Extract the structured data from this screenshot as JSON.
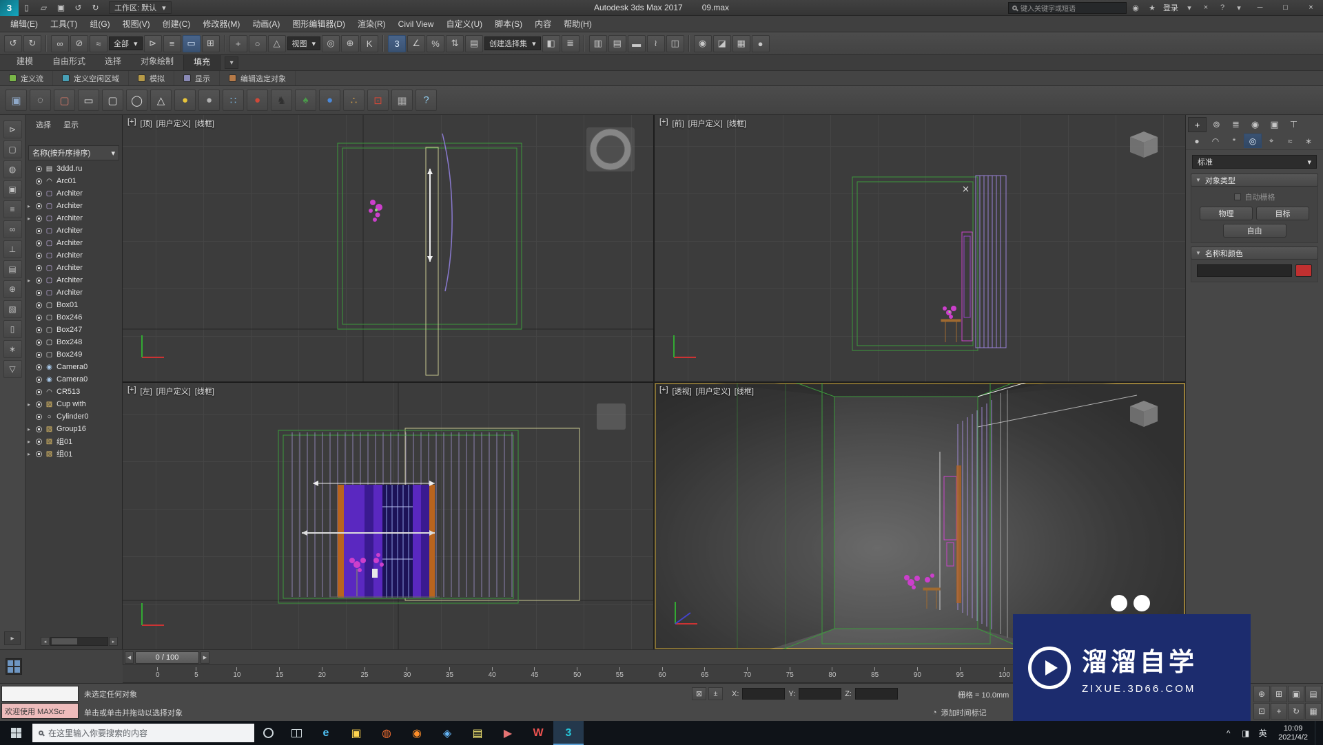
{
  "ui": {
    "caret_down": "▾",
    "arrow_left": "◀",
    "arrow_right": "▶",
    "arrow_small_left": "◂",
    "arrow_small_right": "▸",
    "roll_open": "▼"
  },
  "window": {
    "minimize": "─",
    "maximize": "□",
    "close": "×"
  },
  "titlebar": {
    "logo_glyph": "3",
    "workspace": "工作区: 默认",
    "app_title": "Autodesk 3ds Max 2017",
    "file_title": "09.max",
    "search_placeholder": "键入关键字或短语",
    "signin": "登录",
    "quick_icons": [
      {
        "name": "new-scene-icon",
        "glyph": "▯"
      },
      {
        "name": "open-file-icon",
        "glyph": "▱"
      },
      {
        "name": "save-file-icon",
        "glyph": "▣"
      },
      {
        "name": "undo-icon",
        "glyph": "↺"
      },
      {
        "name": "redo-icon",
        "glyph": "↻"
      }
    ],
    "right_icons_a": [
      {
        "name": "communication-center-icon",
        "glyph": "◉"
      },
      {
        "name": "favorites-icon",
        "glyph": "★"
      }
    ],
    "right_icons_b": [
      {
        "name": "autodesk-exchange-icon",
        "glyph": "×"
      },
      {
        "name": "infocenter-help-icon",
        "glyph": "?"
      }
    ]
  },
  "menus": [
    {
      "label": "编辑(E)",
      "name": "menu-edit"
    },
    {
      "label": "工具(T)",
      "name": "menu-tools"
    },
    {
      "label": "组(G)",
      "name": "menu-group"
    },
    {
      "label": "视图(V)",
      "name": "menu-views"
    },
    {
      "label": "创建(C)",
      "name": "menu-create"
    },
    {
      "label": "修改器(M)",
      "name": "menu-modifiers"
    },
    {
      "label": "动画(A)",
      "name": "menu-animation"
    },
    {
      "label": "图形编辑器(D)",
      "name": "menu-graph-editors"
    },
    {
      "label": "渲染(R)",
      "name": "menu-rendering"
    },
    {
      "label": "Civil View",
      "name": "menu-civil-view"
    },
    {
      "label": "自定义(U)",
      "name": "menu-customize"
    },
    {
      "label": "脚本(S)",
      "name": "menu-scripting"
    },
    {
      "label": "内容",
      "name": "menu-content"
    },
    {
      "label": "帮助(H)",
      "name": "menu-help"
    }
  ],
  "main_toolbar": {
    "filter_dropdown": "全部",
    "coord_dropdown": "视图",
    "sets_dropdown": "创建选择集",
    "group1": [
      {
        "name": "undo-icon",
        "glyph": "↺"
      },
      {
        "name": "redo-icon",
        "glyph": "↻"
      }
    ],
    "group2": [
      {
        "name": "select-and-link-icon",
        "glyph": "∞"
      },
      {
        "name": "unlink-selection-icon",
        "glyph": "⊘"
      },
      {
        "name": "bind-to-space-warp-icon",
        "glyph": "≈"
      }
    ],
    "group3": [
      {
        "name": "select-object-icon",
        "glyph": "⊳"
      },
      {
        "name": "select-by-name-icon",
        "glyph": "≡"
      },
      {
        "name": "rectangular-selection-region-icon",
        "glyph": "▭",
        "cls": "hl"
      },
      {
        "name": "window-crossing-toggle-icon",
        "glyph": "⊞"
      }
    ],
    "group4": [
      {
        "name": "select-and-move-icon",
        "glyph": "+"
      },
      {
        "name": "select-and-rotate-icon",
        "glyph": "○"
      },
      {
        "name": "select-and-scale-icon",
        "glyph": "△"
      }
    ],
    "group5": [
      {
        "name": "use-pivot-center-icon",
        "glyph": "◎"
      },
      {
        "name": "select-and-manipulate-icon",
        "glyph": "⊕"
      },
      {
        "name": "keyboard-override-icon",
        "glyph": "K"
      }
    ],
    "group6": [
      {
        "name": "snaps-toggle-icon",
        "glyph": "3",
        "cls": "hl"
      },
      {
        "name": "angle-snap-icon",
        "glyph": "∠"
      },
      {
        "name": "percent-snap-icon",
        "glyph": "%"
      },
      {
        "name": "spinner-snap-icon",
        "glyph": "⇅"
      }
    ],
    "group7": [
      {
        "name": "edit-named-selection-sets-icon",
        "glyph": "▤"
      }
    ],
    "group8": [
      {
        "name": "mirror-icon",
        "glyph": "◧"
      },
      {
        "name": "align-icon",
        "glyph": "≣"
      }
    ],
    "group9": [
      {
        "name": "toggle-scene-explorer-icon",
        "glyph": "▥"
      },
      {
        "name": "toggle-layer-explorer-icon",
        "glyph": "▤"
      },
      {
        "name": "toggle-ribbon-icon",
        "glyph": "▬"
      }
    ],
    "group10": [
      {
        "name": "curve-editor-icon",
        "glyph": "≀"
      },
      {
        "name": "schematic-view-icon",
        "glyph": "◫"
      }
    ],
    "group11": [
      {
        "name": "material-editor-icon",
        "glyph": "◉"
      },
      {
        "name": "render-setup-icon",
        "glyph": "◪"
      },
      {
        "name": "rendered-frame-icon",
        "glyph": "▦"
      },
      {
        "name": "render-production-icon",
        "glyph": "●"
      }
    ]
  },
  "ribbon": {
    "tabs": [
      {
        "label": "建模",
        "name": "ribbon-tab-modeling"
      },
      {
        "label": "自由形式",
        "name": "ribbon-tab-freeform"
      },
      {
        "label": "选择",
        "name": "ribbon-tab-selection"
      },
      {
        "label": "对象绘制",
        "name": "ribbon-tab-object-paint"
      },
      {
        "label": "填充",
        "name": "ribbon-tab-populate"
      }
    ],
    "active_index": 4,
    "sub_buttons": [
      {
        "label": "定义流",
        "color": "#7ab648",
        "name": "populate-define-flow-button"
      },
      {
        "label": "定义空闲区域",
        "color": "#48a0b6",
        "name": "populate-define-idle-area-button"
      },
      {
        "label": "模拟",
        "color": "#b69a48",
        "name": "populate-simulate-button"
      },
      {
        "label": "显示",
        "color": "#8a8ab6",
        "name": "populate-display-button"
      },
      {
        "label": "编辑选定对象",
        "color": "#b67a48",
        "name": "populate-edit-selected-button"
      }
    ]
  },
  "secondary_toolbar": {
    "icons": [
      {
        "name": "viewport-tool-icon",
        "glyph": "▣",
        "color": "#8fa8c8"
      },
      {
        "name": "cloud-icon",
        "glyph": "◌",
        "color": "#d8d8d8"
      },
      {
        "name": "display-monitor-icon",
        "glyph": "▢",
        "color": "#d87a6a"
      },
      {
        "name": "rectangle-tool-icon",
        "glyph": "▭",
        "color": "#e0e0e0"
      },
      {
        "name": "rounded-rectangle-tool-icon",
        "glyph": "▢",
        "color": "#e0e0e0"
      },
      {
        "name": "ellipse-tool-icon",
        "glyph": "◯",
        "color": "#e0e0e0"
      },
      {
        "name": "cone-tool-icon",
        "glyph": "△",
        "color": "#e0e0e0"
      },
      {
        "name": "sun-light-icon",
        "glyph": "●",
        "color": "#e8c53a"
      },
      {
        "name": "sphere-tool-icon",
        "glyph": "●",
        "color": "#b0b0b0"
      },
      {
        "name": "scatter-grid-icon",
        "glyph": "∷",
        "color": "#7ab0d8"
      },
      {
        "name": "red-sphere-icon",
        "glyph": "●",
        "color": "#d04838"
      },
      {
        "name": "figure-icon",
        "glyph": "♞",
        "color": "#303030"
      },
      {
        "name": "foliage-icon",
        "glyph": "♠",
        "color": "#4a9a4a"
      },
      {
        "name": "blue-sphere-icon",
        "glyph": "●",
        "color": "#4a88d8"
      },
      {
        "name": "color-dots-icon",
        "glyph": "∴",
        "color": "#d8a04a"
      },
      {
        "name": "target-point-icon",
        "glyph": "⊡",
        "color": "#d04838"
      },
      {
        "name": "building-icon",
        "glyph": "▦",
        "color": "#a8a8a8"
      },
      {
        "name": "help-icon",
        "glyph": "?",
        "color": "#8fc8e8"
      }
    ]
  },
  "left_strip": {
    "icons": [
      {
        "name": "select-cursor-icon",
        "glyph": "⊳"
      },
      {
        "name": "selection-window-icon",
        "glyph": "▢"
      },
      {
        "name": "lamp-icon",
        "glyph": "◍"
      },
      {
        "name": "monitor-icon",
        "glyph": "▣"
      },
      {
        "name": "panel-list-icon",
        "glyph": "≡"
      },
      {
        "name": "link-chain-icon",
        "glyph": "∞"
      },
      {
        "name": "wrench-icon",
        "glyph": "⊥"
      },
      {
        "name": "palette-icon",
        "glyph": "▤"
      },
      {
        "name": "target-icon",
        "glyph": "⊕"
      },
      {
        "name": "cube-icon",
        "glyph": "▧"
      },
      {
        "name": "document-icon",
        "glyph": "▯"
      },
      {
        "name": "asterisk-icon",
        "glyph": "∗"
      },
      {
        "name": "filter-icon",
        "glyph": "▽"
      }
    ]
  },
  "scene_explorer": {
    "menu_select": "选择",
    "menu_display": "显示",
    "sort_header": "名称(按升序排序)",
    "items": [
      {
        "label": "3ddd.ru",
        "icon_name": "layer-icon",
        "glyph": "▤",
        "color": "#d8d8d8",
        "arrow": ""
      },
      {
        "label": "Arc01",
        "icon_name": "arc-shape-icon",
        "glyph": "◠",
        "color": "#d8d8d8",
        "arrow": ""
      },
      {
        "label": "Architer",
        "icon_name": "architecture-object-icon",
        "glyph": "▢",
        "color": "#c8b4e8",
        "arrow": ""
      },
      {
        "label": "Architer",
        "icon_name": "architecture-object-icon",
        "glyph": "▢",
        "color": "#c8b4e8",
        "arrow": "▸"
      },
      {
        "label": "Architer",
        "icon_name": "architecture-object-icon",
        "glyph": "▢",
        "color": "#c8b4e8",
        "arrow": "▸"
      },
      {
        "label": "Architer",
        "icon_name": "architecture-object-icon",
        "glyph": "▢",
        "color": "#c8b4e8",
        "arrow": ""
      },
      {
        "label": "Architer",
        "icon_name": "architecture-object-icon",
        "glyph": "▢",
        "color": "#c8b4e8",
        "arrow": ""
      },
      {
        "label": "Architer",
        "icon_name": "architecture-object-icon",
        "glyph": "▢",
        "color": "#c8b4e8",
        "arrow": ""
      },
      {
        "label": "Architer",
        "icon_name": "architecture-object-icon",
        "glyph": "▢",
        "color": "#c8b4e8",
        "arrow": ""
      },
      {
        "label": "Architer",
        "icon_name": "architecture-object-icon",
        "glyph": "▢",
        "color": "#c8b4e8",
        "arrow": "▸"
      },
      {
        "label": "Architer",
        "icon_name": "architecture-object-icon",
        "glyph": "▢",
        "color": "#c8b4e8",
        "arrow": ""
      },
      {
        "label": "Box01",
        "icon_name": "box-object-icon",
        "glyph": "▢",
        "color": "#d8d8d8",
        "arrow": ""
      },
      {
        "label": "Box246",
        "icon_name": "box-object-icon",
        "glyph": "▢",
        "color": "#d8d8d8",
        "arrow": ""
      },
      {
        "label": "Box247",
        "icon_name": "box-object-icon",
        "glyph": "▢",
        "color": "#d8d8d8",
        "arrow": ""
      },
      {
        "label": "Box248",
        "icon_name": "box-object-icon",
        "glyph": "▢",
        "color": "#d8d8d8",
        "arrow": ""
      },
      {
        "label": "Box249",
        "icon_name": "box-object-icon",
        "glyph": "▢",
        "color": "#d8d8d8",
        "arrow": ""
      },
      {
        "label": "Camera0",
        "icon_name": "camera-object-icon",
        "glyph": "◉",
        "color": "#a8c8e8",
        "arrow": ""
      },
      {
        "label": "Camera0",
        "icon_name": "camera-object-icon",
        "glyph": "◉",
        "color": "#a8c8e8",
        "arrow": ""
      },
      {
        "label": "CR513",
        "icon_name": "shape-object-icon",
        "glyph": "◠",
        "color": "#d8d8d8",
        "arrow": ""
      },
      {
        "label": "Cup with",
        "icon_name": "group-icon",
        "glyph": "▧",
        "color": "#e8c56a",
        "arrow": "▸"
      },
      {
        "label": "Cylinder0",
        "icon_name": "cylinder-object-icon",
        "glyph": "○",
        "color": "#d8d8d8",
        "arrow": ""
      },
      {
        "label": "Group16",
        "icon_name": "group-icon",
        "glyph": "▧",
        "color": "#e8c56a",
        "arrow": "▸"
      },
      {
        "label": "组01",
        "icon_name": "group-icon",
        "glyph": "▧",
        "color": "#e8c56a",
        "arrow": "▸"
      },
      {
        "label": "组01",
        "icon_name": "group-icon",
        "glyph": "▧",
        "color": "#e8c56a",
        "arrow": "▸"
      }
    ]
  },
  "viewports": {
    "top_left": {
      "menu": "[+]",
      "view": "[顶]",
      "pov": "[用户定义]",
      "shading": "[线框]"
    },
    "top_right": {
      "menu": "[+]",
      "view": "[前]",
      "pov": "[用户定义]",
      "shading": "[线框]"
    },
    "bottom_left": {
      "menu": "[+]",
      "view": "[左]",
      "pov": "[用户定义]",
      "shading": "[线框]"
    },
    "bottom_right": {
      "menu": "[+]",
      "view": "[透视]",
      "pov": "[用户定义]",
      "shading": "[线框]"
    }
  },
  "command_panel": {
    "tabs": [
      {
        "name": "panel-tab-create-icon",
        "glyph": "+"
      },
      {
        "name": "panel-tab-modify-icon",
        "glyph": "⊚"
      },
      {
        "name": "panel-tab-hierarchy-icon",
        "glyph": "≣"
      },
      {
        "name": "panel-tab-motion-icon",
        "glyph": "◉"
      },
      {
        "name": "panel-tab-display-icon",
        "glyph": "▣"
      },
      {
        "name": "panel-tab-utilities-icon",
        "glyph": "⊤"
      }
    ],
    "active_tab_index": 0,
    "categories": [
      {
        "name": "create-geometry-icon",
        "glyph": "●"
      },
      {
        "name": "create-shapes-icon",
        "glyph": "◠"
      },
      {
        "name": "create-lights-icon",
        "glyph": "*"
      },
      {
        "name": "create-cameras-icon",
        "glyph": "◎"
      },
      {
        "name": "create-helpers-icon",
        "glyph": "⌖"
      },
      {
        "name": "create-spacewarps-icon",
        "glyph": "≈"
      },
      {
        "name": "create-systems-icon",
        "glyph": "∗"
      }
    ],
    "active_category_index": 3,
    "camera_type_dropdown": "标准",
    "object_type_title": "对象类型",
    "autogrid_label": "自动栅格",
    "buttons": [
      {
        "label": "物理",
        "name": "physical-camera-button"
      },
      {
        "label": "目标",
        "name": "target-camera-button"
      },
      {
        "label": "自由",
        "name": "free-camera-button",
        "cls": "wide"
      }
    ],
    "name_color": {
      "title": "名称和颜色",
      "swatch_color": "#c03030"
    }
  },
  "timeline": {
    "frame_display": "0 / 100",
    "ticks": [
      "0",
      "5",
      "10",
      "15",
      "20",
      "25",
      "30",
      "35",
      "40",
      "45",
      "50",
      "55",
      "60",
      "65",
      "70",
      "75",
      "80",
      "85",
      "90",
      "95",
      "100"
    ]
  },
  "status_bar": {
    "prompt_line1": "未选定任何对象",
    "prompt_line2": "单击或单击并拖动以选择对象",
    "maxscript_label": "欢迎使用 MAXScr",
    "x_label": "X:",
    "y_label": "Y:",
    "z_label": "Z:",
    "grid_label": "栅格 = 10.0mm",
    "time_tag_label": "添加时间标记",
    "time_tag_icon": {
      "name": "time-tag-clock-icon",
      "glyph": "◔"
    },
    "lock_icons": [
      {
        "name": "selection-lock-toggle-icon",
        "glyph": "⊠"
      },
      {
        "name": "absolute-offset-mode-icon",
        "glyph": "±"
      }
    ],
    "nav_icons": [
      {
        "name": "zoom-icon",
        "glyph": "⊕"
      },
      {
        "name": "zoom-all-icon",
        "glyph": "⊞"
      },
      {
        "name": "zoom-extents-icon",
        "glyph": "▣"
      },
      {
        "name": "zoom-extents-all-icon",
        "glyph": "▤"
      },
      {
        "name": "zoom-region-icon",
        "glyph": "⊡"
      },
      {
        "name": "pan-icon",
        "glyph": "+"
      },
      {
        "name": "orbit-icon",
        "glyph": "↻"
      },
      {
        "name": "maximize-viewport-toggle-icon",
        "glyph": "▦"
      }
    ]
  },
  "taskbar": {
    "search_placeholder": "在这里输入你要搜索的内容",
    "app_icons": [
      {
        "name": "edge-icon",
        "glyph": "e",
        "color": "#4fc3f7"
      },
      {
        "name": "file-explorer-icon",
        "glyph": "▣",
        "color": "#ffd54f"
      },
      {
        "name": "browser-icon",
        "glyph": "◍",
        "color": "#ef6c30"
      },
      {
        "name": "firefox-icon",
        "glyph": "◉",
        "color": "#ff8f2a"
      },
      {
        "name": "mail-icon",
        "glyph": "◈",
        "color": "#64b5f6"
      },
      {
        "name": "notes-icon",
        "glyph": "▤",
        "color": "#fff176"
      },
      {
        "name": "media-player-icon",
        "glyph": "▶",
        "color": "#e57373"
      },
      {
        "name": "wps-icon",
        "glyph": "W",
        "color": "#ef5350"
      },
      {
        "name": "3dsmax-taskbar-icon",
        "glyph": "3",
        "color": "#26c6da"
      }
    ],
    "active_icon_index": 8,
    "tray": [
      {
        "name": "tray-expand-icon",
        "glyph": "^"
      },
      {
        "name": "ime-mode-icon",
        "glyph": "◨"
      },
      {
        "name": "language-indicator",
        "glyph": "英"
      }
    ],
    "time": "10:09",
    "date": "2021/4/2"
  },
  "watermark": {
    "brand": "溜溜自学",
    "domain": "ZIXUE.3D66.COM",
    "bg": "#1c2c6e"
  }
}
